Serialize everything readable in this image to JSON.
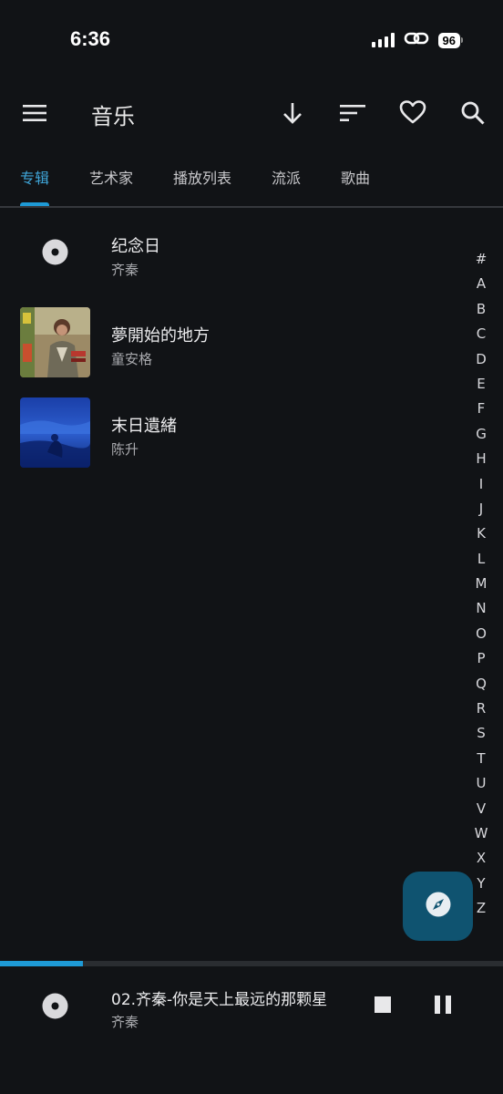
{
  "status_bar": {
    "time": "6:36",
    "battery": "96"
  },
  "app_bar": {
    "title": "音乐"
  },
  "tabs": [
    {
      "label": "专辑",
      "active": true
    },
    {
      "label": "艺术家",
      "active": false
    },
    {
      "label": "播放列表",
      "active": false
    },
    {
      "label": "流派",
      "active": false
    },
    {
      "label": "歌曲",
      "active": false
    }
  ],
  "albums": [
    {
      "title": "纪念日",
      "artist": "齐秦",
      "art": "disc-placeholder"
    },
    {
      "title": "夢開始的地方",
      "artist": "童安格",
      "art": "album-cover-portrait"
    },
    {
      "title": "末日遺緒",
      "artist": "陈升",
      "art": "album-cover-blue"
    }
  ],
  "alphabet_index": [
    "#",
    "A",
    "B",
    "C",
    "D",
    "E",
    "F",
    "G",
    "H",
    "I",
    "J",
    "K",
    "L",
    "M",
    "N",
    "O",
    "P",
    "Q",
    "R",
    "S",
    "T",
    "U",
    "V",
    "W",
    "X",
    "Y",
    "Z"
  ],
  "now_playing": {
    "title": "02.齐秦-你是天上最远的那颗星",
    "artist": "齐秦",
    "progress": 0.165
  },
  "colors": {
    "background": "#111316",
    "accent": "#1e9ad6",
    "fab": "#0f5370"
  }
}
